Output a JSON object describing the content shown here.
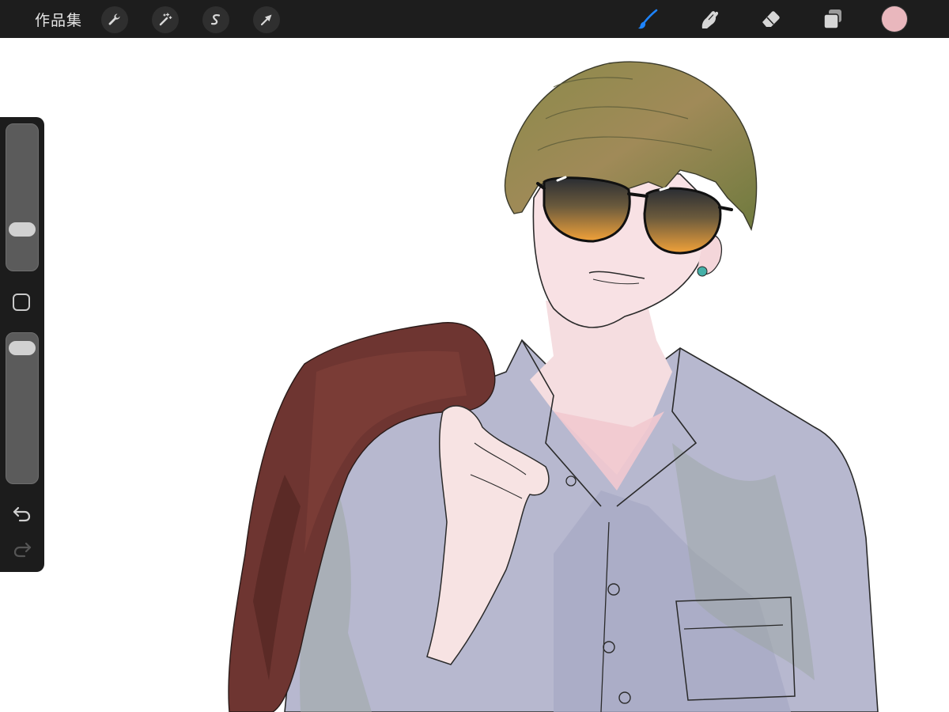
{
  "toolbar": {
    "gallery_label": "作品集",
    "left_tools": [
      {
        "name": "actions",
        "icon": "wrench-icon"
      },
      {
        "name": "adjustments",
        "icon": "magic-wand-icon"
      },
      {
        "name": "selection",
        "icon": "selection-s-icon"
      },
      {
        "name": "transform",
        "icon": "arrow-cursor-icon"
      }
    ],
    "right_tools": [
      {
        "name": "brush",
        "icon": "brush-icon",
        "active": true
      },
      {
        "name": "smudge",
        "icon": "smudge-finger-icon",
        "active": false
      },
      {
        "name": "eraser",
        "icon": "eraser-icon",
        "active": false
      },
      {
        "name": "layers",
        "icon": "layers-icon",
        "active": false
      }
    ],
    "current_color": "#e9b7bd",
    "active_color": "#1e84ff"
  },
  "sidebar": {
    "brush_size_level": 0.25,
    "opacity_level": 0.96,
    "modify_button_icon": "square-icon",
    "undo_icon": "undo-arrow-icon",
    "redo_icon": "redo-arrow-icon",
    "redo_enabled": false
  },
  "canvas": {
    "artwork": "illustration-man-with-sunglasses-and-jacket"
  }
}
